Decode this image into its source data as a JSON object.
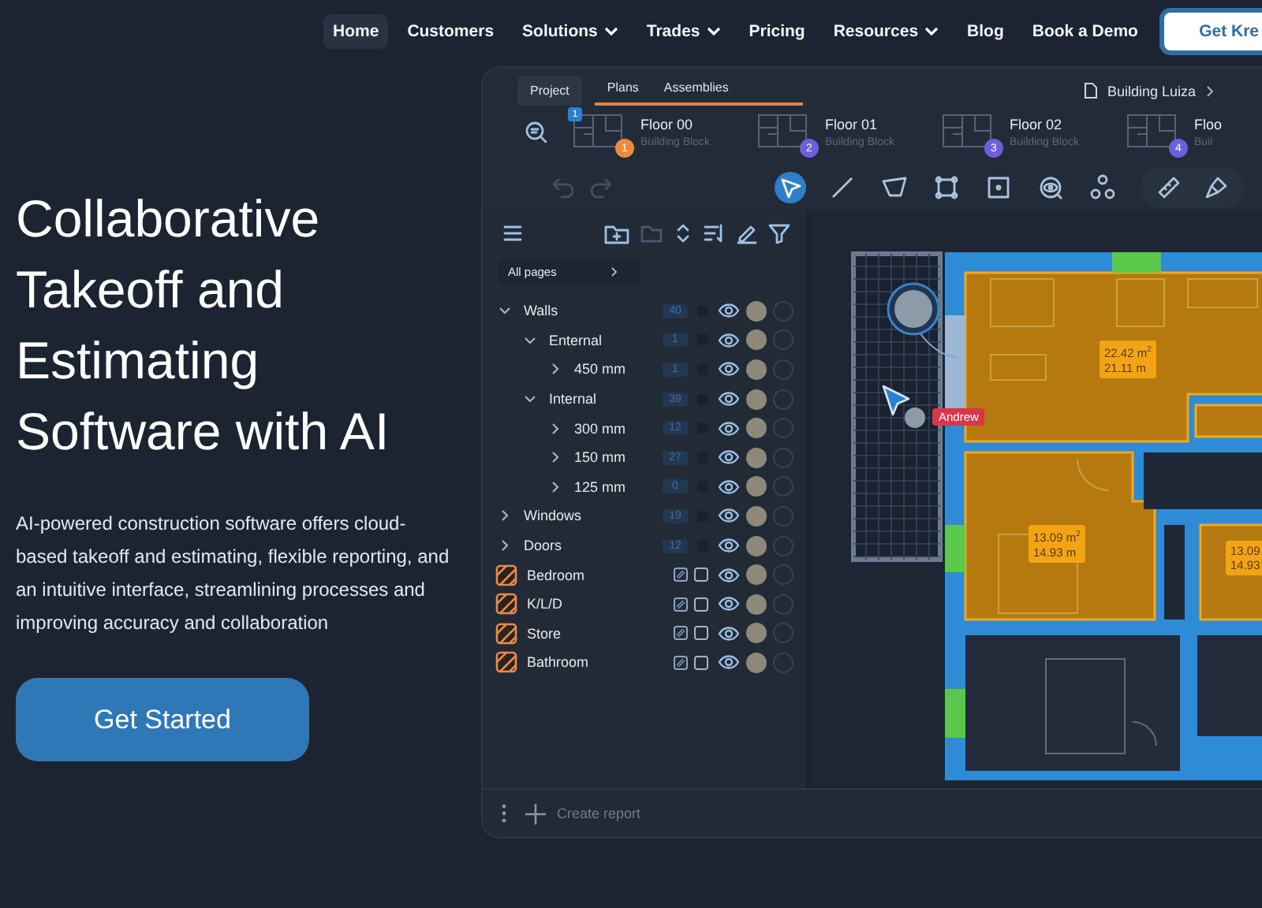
{
  "nav": {
    "items": [
      {
        "label": "Home",
        "selected": true,
        "dropdown": false
      },
      {
        "label": "Customers",
        "selected": false,
        "dropdown": false
      },
      {
        "label": "Solutions",
        "selected": false,
        "dropdown": true
      },
      {
        "label": "Trades",
        "selected": false,
        "dropdown": true
      },
      {
        "label": "Pricing",
        "selected": false,
        "dropdown": false
      },
      {
        "label": "Resources",
        "selected": false,
        "dropdown": true
      },
      {
        "label": "Blog",
        "selected": false,
        "dropdown": false
      },
      {
        "label": "Book a Demo",
        "selected": false,
        "dropdown": false
      }
    ],
    "cta": "Get Kre"
  },
  "hero": {
    "title": "Collaborative Takeoff and Estimating Software with AI",
    "description": "AI-powered construction software offers cloud-based takeoff and estimating, flexible reporting, and an intuitive interface, streamlining processes and improving accuracy and collaboration",
    "button": "Get Started"
  },
  "app": {
    "tabs": [
      {
        "label": "Project",
        "selected": true
      }
    ],
    "views": {
      "underlined": true,
      "items": [
        "Plans",
        "Assemblies"
      ]
    },
    "breadcrumb": "Building Luiza",
    "floors": [
      {
        "title": "Floor 00",
        "subtitle": "Building Block",
        "badge": "1",
        "color": "#ee8a3c",
        "marker": "1"
      },
      {
        "title": "Floor 01",
        "subtitle": "Building Block",
        "badge": "2",
        "color": "#6c5fdc"
      },
      {
        "title": "Floor 02",
        "subtitle": "Building Block",
        "badge": "3",
        "color": "#6c5fdc"
      },
      {
        "title": "Floo",
        "subtitle": "Buil",
        "badge": "4",
        "color": "#6c5fdc"
      }
    ],
    "history": [
      {
        "kind": "undo",
        "disabled": true
      },
      {
        "kind": "redo",
        "disabled": true
      }
    ],
    "tools": [
      {
        "kind": "select",
        "selected": true
      },
      {
        "kind": "line",
        "selected": false
      },
      {
        "kind": "polygon",
        "selected": false
      },
      {
        "kind": "crop",
        "selected": false
      },
      {
        "kind": "rectangle",
        "selected": false
      },
      {
        "kind": "eye",
        "selected": false
      },
      {
        "kind": "nodes",
        "selected": false
      },
      {
        "kind": "ruler",
        "selected": false
      },
      {
        "kind": "brush",
        "selected": false
      }
    ],
    "panel": {
      "filter": "All pages",
      "tree": [
        {
          "label": "Walls",
          "count": "40",
          "expanded": true,
          "children": [
            {
              "label": "Enternal",
              "count": "1",
              "expanded": true,
              "children": [
                {
                  "label": "450 mm",
                  "count": "1",
                  "expanded": false
                }
              ]
            },
            {
              "label": "Internal",
              "count": "39",
              "expanded": true,
              "children": [
                {
                  "label": "300 mm",
                  "count": "12",
                  "expanded": false
                },
                {
                  "label": "150 mm",
                  "count": "27",
                  "expanded": false
                },
                {
                  "label": "125 mm",
                  "count": "0",
                  "expanded": false
                }
              ]
            }
          ]
        },
        {
          "label": "Windows",
          "count": "19",
          "expanded": false
        },
        {
          "label": "Doors",
          "count": "12",
          "expanded": false
        }
      ],
      "areas": [
        {
          "label": "Bedroom"
        },
        {
          "label": "K/L/D"
        },
        {
          "label": "Store"
        },
        {
          "label": "Bathroom"
        }
      ]
    },
    "canvas": {
      "measurements": [
        {
          "area": "22.42 m$^{2}$",
          "perimeter": "21.11 m"
        },
        {
          "area": "13.09 m$^{2}$",
          "perimeter": "14.93 m"
        },
        {
          "area": "13.09",
          "perimeter": "14.93"
        }
      ],
      "collaborator": "Andrew"
    },
    "footer": {
      "action": "Create report"
    }
  }
}
